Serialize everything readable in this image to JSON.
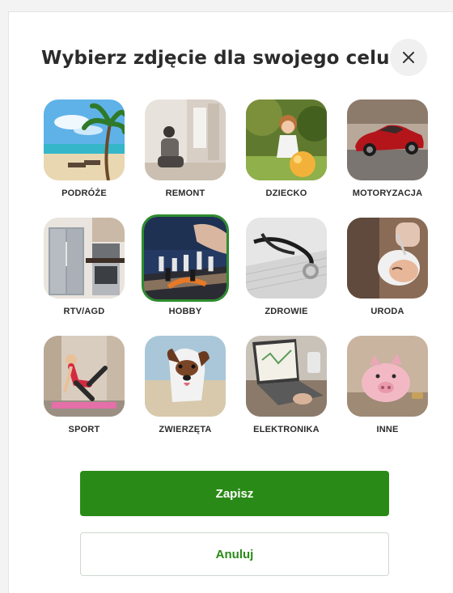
{
  "dialog": {
    "title": "Wybierz zdjęcie dla swojego celu",
    "close_icon": "close-icon"
  },
  "categories": [
    {
      "label": "PODRÓŻE",
      "icon": "beach-photo",
      "selected": false
    },
    {
      "label": "REMONT",
      "icon": "renovation-photo",
      "selected": false
    },
    {
      "label": "DZIECKO",
      "icon": "child-photo",
      "selected": false
    },
    {
      "label": "MOTORYZACJA",
      "icon": "car-photo",
      "selected": false
    },
    {
      "label": "RTV/AGD",
      "icon": "kitchen-appliances-photo",
      "selected": false
    },
    {
      "label": "HOBBY",
      "icon": "chess-photo",
      "selected": true
    },
    {
      "label": "ZDROWIE",
      "icon": "stethoscope-photo",
      "selected": false
    },
    {
      "label": "URODA",
      "icon": "beauty-photo",
      "selected": false
    },
    {
      "label": "SPORT",
      "icon": "fitness-photo",
      "selected": false
    },
    {
      "label": "ZWIERZĘTA",
      "icon": "dog-photo",
      "selected": false
    },
    {
      "label": "ELEKTRONIKA",
      "icon": "laptop-photo",
      "selected": false
    },
    {
      "label": "INNE",
      "icon": "piggy-bank-photo",
      "selected": false
    }
  ],
  "actions": {
    "save_label": "Zapisz",
    "cancel_label": "Anuluj"
  },
  "colors": {
    "primary": "#2a8a17",
    "selected_border": "#2e8b2e"
  }
}
